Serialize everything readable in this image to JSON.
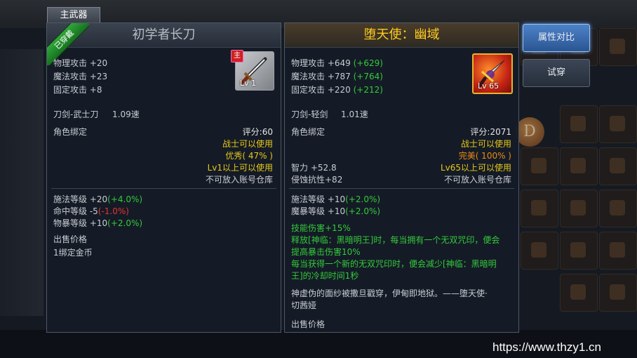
{
  "tab": {
    "label": "主武器"
  },
  "equipped": {
    "badge": "已穿戴",
    "name": "初学者长刀",
    "main_tag": "主",
    "level": "Lv 1",
    "stats": [
      "物理攻击 +20",
      "魔法攻击 +23",
      "固定攻击 +8"
    ],
    "weapon_type": "刀剑-武士刀",
    "speed": "1.09速",
    "binding": "角色绑定",
    "score": "评分:60",
    "class_req": "战士可以使用",
    "quality": "优秀( 47% )",
    "level_req": "Lv1以上可以使用",
    "account_storage": "不可放入账号仓库",
    "sub_stats": [
      {
        "label": "施法等级 +20",
        "delta": "(+4.0%)",
        "color": "g"
      },
      {
        "label": "命中等级 -5",
        "delta": "(-1.0%)",
        "color": "r"
      },
      {
        "label": "物暴等级 +10",
        "delta": "(+2.0%)",
        "color": "g"
      }
    ],
    "sell_label": "出售价格",
    "sell_value": "1绑定金币"
  },
  "compare": {
    "name": "堕天使：幽域",
    "level": "Lv 65",
    "stats": [
      {
        "label": "物理攻击 +649",
        "delta": "(+629)"
      },
      {
        "label": "魔法攻击 +787",
        "delta": "(+764)"
      },
      {
        "label": "固定攻击 +220",
        "delta": "(+212)"
      }
    ],
    "weapon_type": "刀剑-轻剑",
    "speed": "1.01速",
    "binding": "角色绑定",
    "score": "评分:2071",
    "class_req": "战士可以使用",
    "quality": "完美( 100% )",
    "int_stat": "智力 +52.8",
    "corrosion": "侵蚀抗性+82",
    "level_req": "Lv65以上可以使用",
    "account_storage": "不可放入账号仓库",
    "sub_stats": [
      {
        "label": "施法等级 +10",
        "delta": "(+2.0%)"
      },
      {
        "label": "魔暴等级 +10",
        "delta": "(+2.0%)"
      }
    ],
    "skill_lines": [
      "技能伤害+15%",
      "释放[神临：黑暗明王]时，每当拥有一个无双咒印，便会",
      "提高暴击伤害10%",
      "每当获得一个新的无双咒印时，便会减少[神临：黑暗明",
      "王]的冷却时间1秒"
    ],
    "lore_lines": [
      "神虚伪的面纱被撒旦戳穿，伊甸即地狱。——堕天使·",
      "切茜娅"
    ],
    "sell_label": "出售价格"
  },
  "buttons": {
    "compare": "属性对比",
    "try_on": "试穿"
  },
  "watermark": "https://www.thzy1.cn",
  "colors": {
    "gain": "#35c93b",
    "loss": "#e23535",
    "gold": "#ffcc1c",
    "excellent": "#e8c81a",
    "perfect": "#f08b12"
  }
}
